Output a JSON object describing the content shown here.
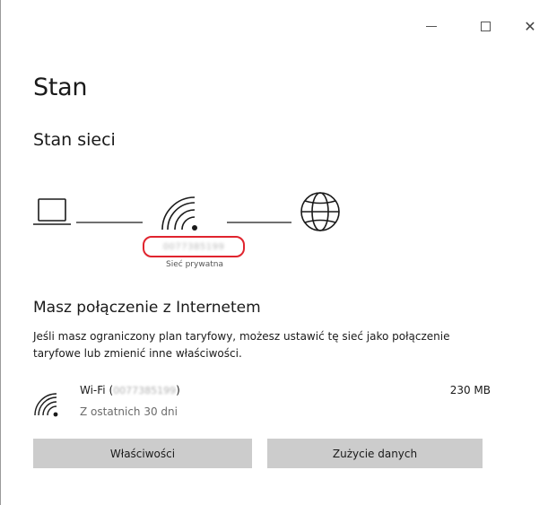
{
  "window": {
    "minimize_icon": "minimize-icon",
    "maximize_icon": "maximize-icon",
    "close_icon": "close-icon",
    "close_glyph": "✕"
  },
  "page": {
    "title": "Stan",
    "section_title": "Stan sieci"
  },
  "diagram": {
    "icons": [
      "laptop-icon",
      "wifi-icon",
      "globe-icon"
    ],
    "network_name": "0077385199",
    "network_type": "Sieć prywatna"
  },
  "connection": {
    "heading": "Masz połączenie z Internetem",
    "description": "Jeśli masz ograniczony plan taryfowy, możesz ustawić tę sieć jako połączenie taryfowe lub zmienić inne właściwości."
  },
  "wifi": {
    "label_prefix": "Wi-Fi (",
    "network_name": "0077385199",
    "label_suffix": ")",
    "subtitle": "Z ostatnich 30 dni",
    "usage": "230 MB"
  },
  "buttons": {
    "properties": "Właściwości",
    "data_usage": "Zużycie danych"
  }
}
